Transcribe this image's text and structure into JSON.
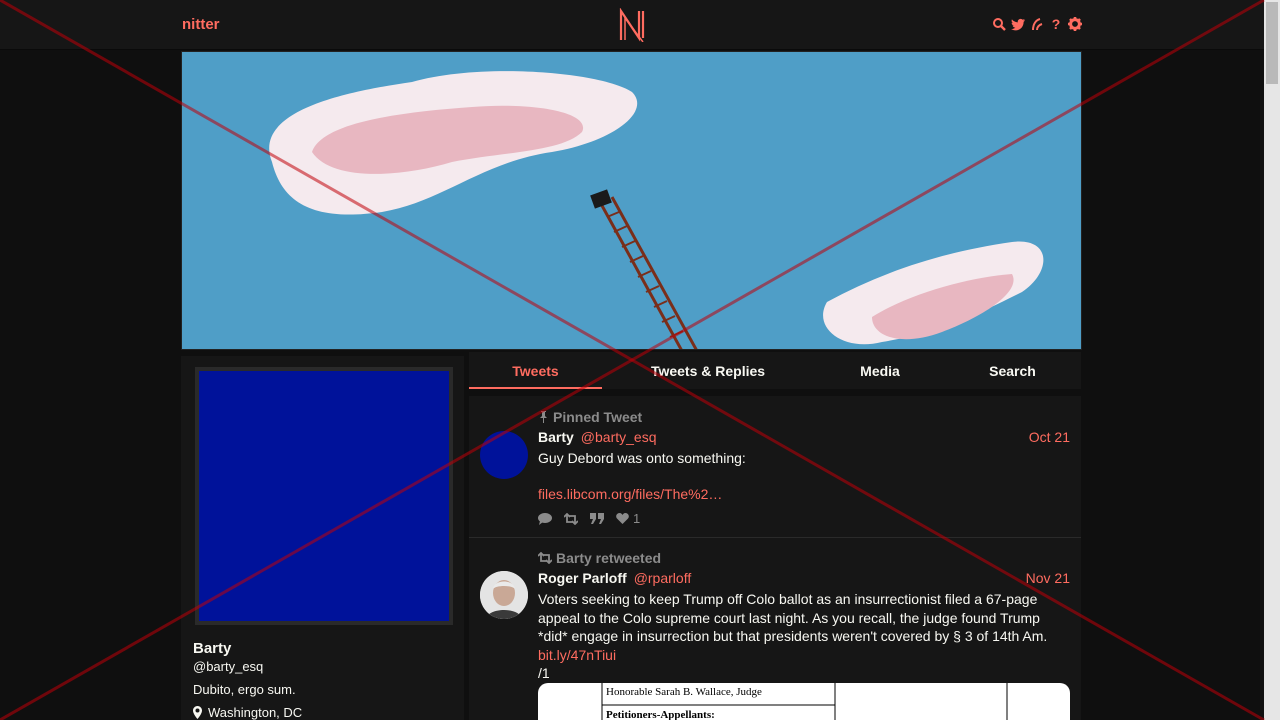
{
  "navbar": {
    "brand": "nitter",
    "logo_letter": "N",
    "icons": [
      "search-icon",
      "twitter-icon",
      "rss-icon",
      "help-icon",
      "settings-icon"
    ],
    "help_glyph": "?"
  },
  "banner": {
    "description": ""
  },
  "profile": {
    "name": "Barty",
    "handle": "@barty_esq",
    "bio": "Dubito, ergo sum.",
    "location": "Washington, DC",
    "avatar_color": "#00129a"
  },
  "tabs": [
    {
      "label": "Tweets",
      "active": true
    },
    {
      "label": "Tweets & Replies",
      "active": false
    },
    {
      "label": "Media",
      "active": false
    },
    {
      "label": "Search",
      "active": false
    }
  ],
  "tweets": [
    {
      "context": "Pinned Tweet",
      "name": "Barty",
      "handle": "@barty_esq",
      "date": "Oct 21",
      "text": "Guy Debord was onto something:",
      "link": "files.libcom.org/files/The%2…",
      "stats": {
        "comments": "",
        "retweets": "",
        "quotes": "",
        "likes": "1"
      }
    },
    {
      "context": "Barty retweeted",
      "name": "Roger Parloff",
      "handle": "@rparloff",
      "date": "Nov 21",
      "text": "Voters seeking to keep Trump off Colo ballot as an insurrectionist filed a 67-page appeal to the Colo supreme court last night. As you recall, the judge found Trump *did* engage in insurrection but that presidents weren't covered by § 3 of 14th Am.",
      "link": "bit.ly/47nTiui",
      "suffix": "/1",
      "attachment": {
        "line1": "Honorable Sarah B. Wallace, Judge",
        "line2": "Petitioners-Appellants:"
      }
    }
  ],
  "colors": {
    "accent": "#ff6c60",
    "background": "#0f0f0f",
    "panel": "#161616",
    "muted": "#8b8b8b"
  }
}
